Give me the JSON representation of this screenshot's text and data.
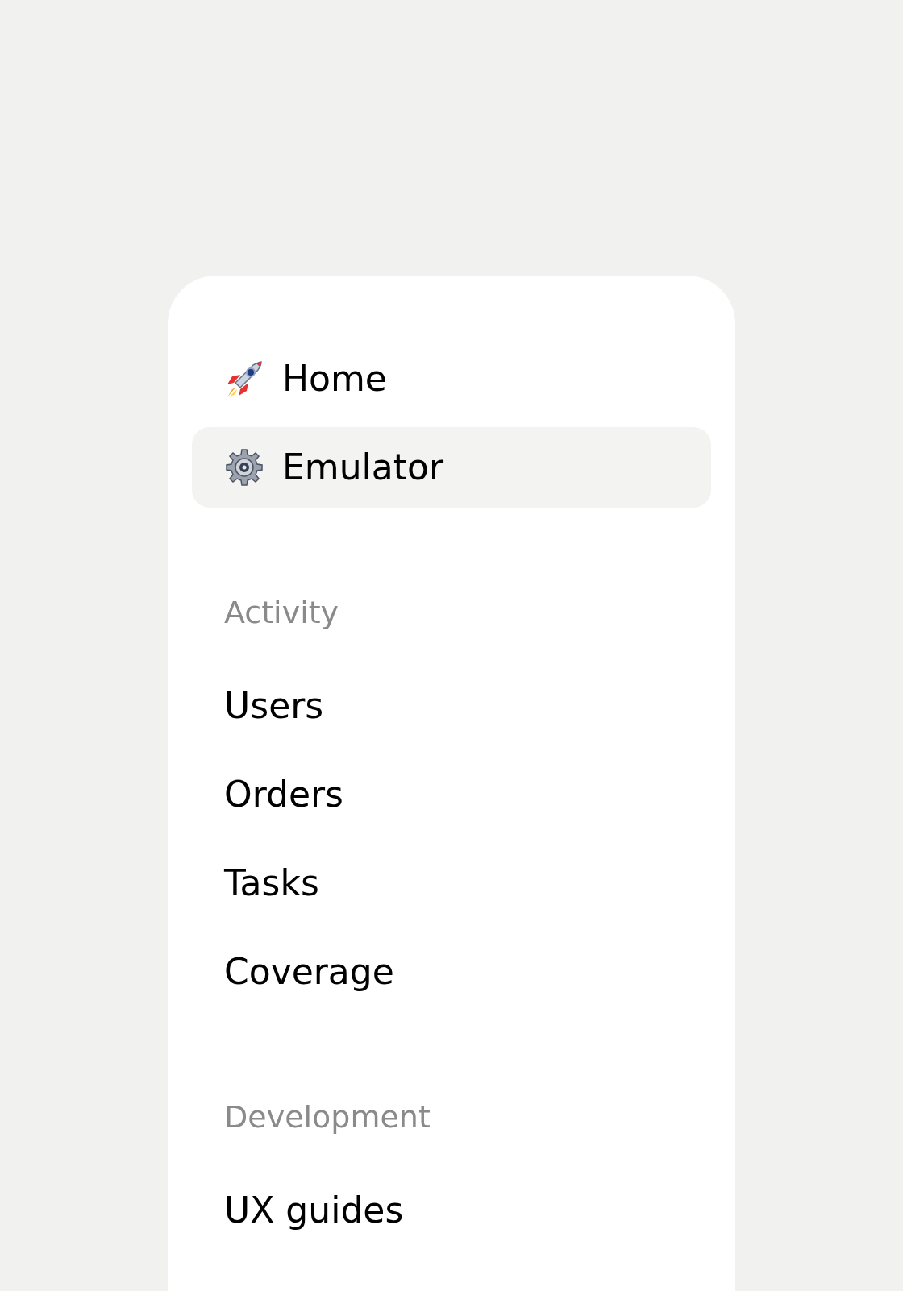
{
  "primary_items": [
    {
      "label": "Home",
      "selected": false
    },
    {
      "label": "Emulator",
      "selected": true
    }
  ],
  "sections": [
    {
      "title": "Activity",
      "items": [
        {
          "label": "Users",
          "selected": false
        },
        {
          "label": "Orders",
          "selected": false
        },
        {
          "label": "Tasks",
          "selected": false
        },
        {
          "label": "Coverage",
          "selected": false
        }
      ]
    },
    {
      "title": "Development",
      "items": [
        {
          "label": "UX guides",
          "selected": false
        }
      ]
    }
  ]
}
